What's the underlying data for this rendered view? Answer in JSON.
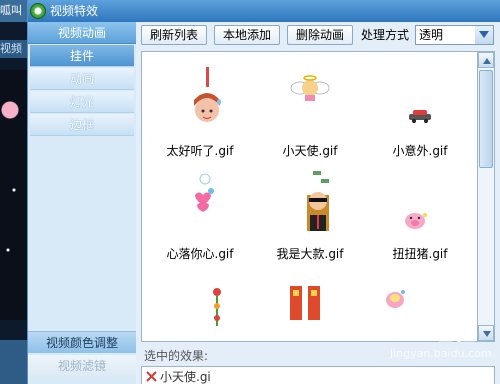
{
  "background_app": {
    "title_partial": "呱叫",
    "tab_partial": "视频"
  },
  "window": {
    "title": "视频特效",
    "icon": "app-logo-icon"
  },
  "nav": {
    "header": "视频动画",
    "items": [
      {
        "label": "挂件",
        "active": true
      },
      {
        "label": "动画",
        "active": false
      },
      {
        "label": "灯光",
        "active": false
      },
      {
        "label": "边框",
        "active": false
      }
    ],
    "bottom": [
      {
        "label": "视频颜色调整",
        "enabled": true
      },
      {
        "label": "视频滤镜",
        "enabled": false
      }
    ]
  },
  "toolbar": {
    "refresh_label": "刷新列表",
    "local_add_label": "本地添加",
    "delete_label": "删除动画",
    "mode_label": "处理方式",
    "mode_value": "透明"
  },
  "grid": {
    "items": [
      {
        "label": "太好听了.gif",
        "icon": "girl-sweat-icon"
      },
      {
        "label": "小天使.gif",
        "icon": "little-angel-icon"
      },
      {
        "label": "小意外.gif",
        "icon": "car-icon"
      },
      {
        "label": "心落你心.gif",
        "icon": "heart-angel-icon"
      },
      {
        "label": "我是大款.gif",
        "icon": "rich-man-icon"
      },
      {
        "label": "扭扭猪.gif",
        "icon": "pig-icon"
      },
      {
        "label": "",
        "icon": "flower-icon"
      },
      {
        "label": "",
        "icon": "banner-icon"
      },
      {
        "label": "",
        "icon": "cake-icon"
      }
    ]
  },
  "selected": {
    "label": "选中的效果:",
    "item": "小天使.gi"
  },
  "watermark": {
    "brand": "Bai 经验",
    "url": "jingyan.baidu.com"
  },
  "colors": {
    "title_bar": "#2f76bd",
    "nav_active": "#4f94d0",
    "window_bg": "#e3eef8"
  }
}
